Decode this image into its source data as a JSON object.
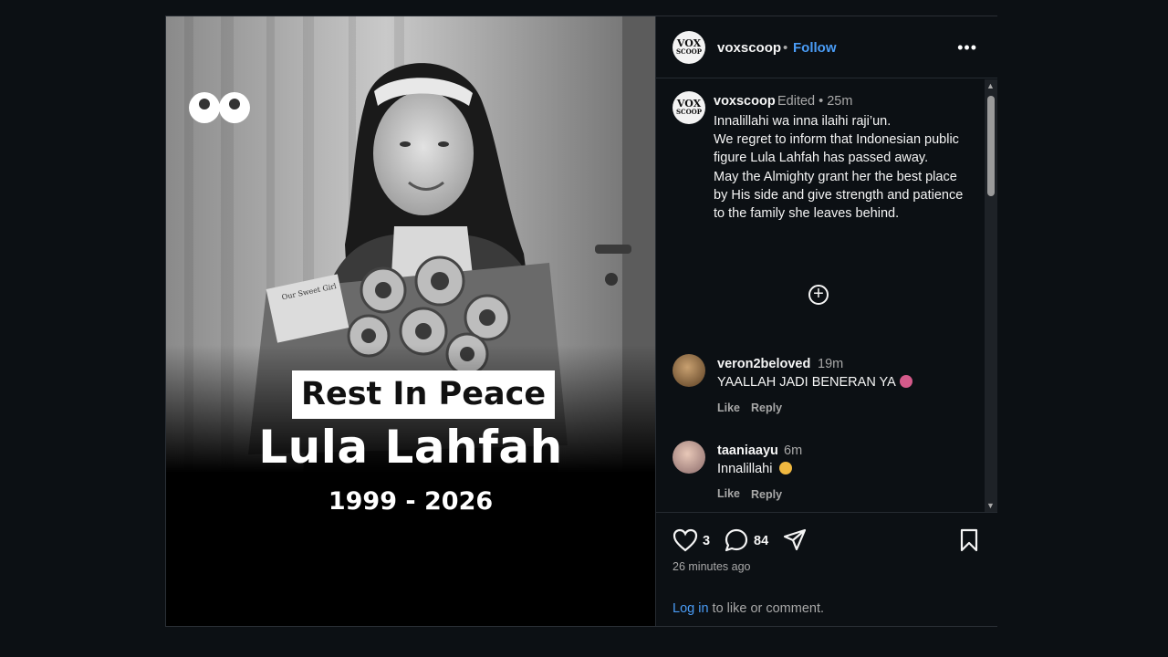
{
  "media": {
    "rip_label": "Rest In Peace",
    "name": "Lula Lahfah",
    "years": "1999 - 2026",
    "card_text": "Our Sweet Girl"
  },
  "header": {
    "username": "voxscoop",
    "separator": "•",
    "follow_label": "Follow",
    "logo_line1": "VOX",
    "logo_line2": "SCOOP"
  },
  "caption": {
    "username": "voxscoop",
    "meta": "Edited •  25m",
    "text": "Innalillahi wa inna ilaihi raji’un.\nWe regret to inform that Indonesian public figure Lula Lahfah has passed away.\nMay the Almighty grant her the best place by His side and give strength and patience to the family she leaves behind."
  },
  "comments": [
    {
      "username": "veron2beloved",
      "time": "19m",
      "text": "YAALLAH JADI BENERAN YA",
      "like_label": "Like",
      "reply_label": "Reply"
    },
    {
      "username": "taaniaayu",
      "time": "6m",
      "text": "Innalillahi",
      "like_label": "Like",
      "reply_label": "Reply"
    }
  ],
  "actions": {
    "likes": "3",
    "comments": "84",
    "timestamp": "26 minutes ago",
    "login_link": "Log in",
    "login_rest": " to like or comment."
  },
  "colors": {
    "background": "#0c1014",
    "accent": "#4a9cf6",
    "muted": "#a8a8a8"
  },
  "icons": [
    "eyes-sticker-icon",
    "more-options-icon",
    "add-circle-icon",
    "heart-icon",
    "comment-icon",
    "share-icon",
    "bookmark-icon"
  ]
}
